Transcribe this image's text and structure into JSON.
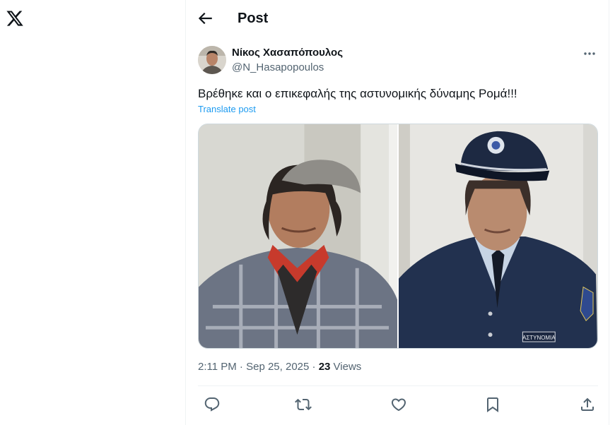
{
  "app": {
    "logo_icon": "x-logo-icon"
  },
  "header": {
    "back_icon": "arrow-left-icon",
    "title": "Post"
  },
  "post": {
    "author_name": "Νίκος Χασαπόπουλος",
    "author_handle": "@N_Hasapopoulos",
    "more_icon": "more-horizontal-icon",
    "text": "Βρέθηκε και ο επικεφαλής της αστυνομικής δύναμης Ρομά!!!",
    "translate_label": "Translate post",
    "badge_text": "ΑΣΤΥΝΟΜΙΑ",
    "time": "2:11 PM",
    "separator": "·",
    "date": "Sep 25, 2025",
    "views_count": "23",
    "views_label": "Views"
  },
  "actions": [
    {
      "icon": "reply-icon"
    },
    {
      "icon": "repost-icon"
    },
    {
      "icon": "like-icon"
    },
    {
      "icon": "bookmark-icon"
    },
    {
      "icon": "share-icon"
    }
  ],
  "colors": {
    "accent": "#1d9bf0",
    "text": "#0f1419",
    "muted": "#536471",
    "border": "#eff3f4"
  }
}
